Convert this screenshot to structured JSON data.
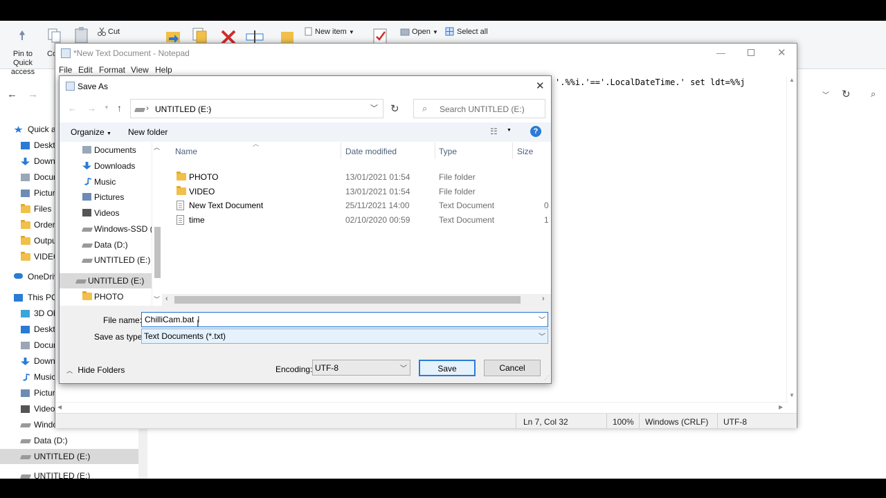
{
  "explorer": {
    "ribbon": {
      "pin_label": "Pin to Quick access",
      "copy_label": "Co",
      "cut_label": "Cut",
      "new_item_label": "New item",
      "open_label": "Open",
      "select_all_label": "Select all"
    },
    "sidebar": {
      "items": [
        {
          "label": "Quick a",
          "icon": "star-icon"
        },
        {
          "label": "Deskt",
          "icon": "desktop-icon"
        },
        {
          "label": "Down",
          "icon": "download-icon"
        },
        {
          "label": "Docur",
          "icon": "documents-icon"
        },
        {
          "label": "Picture",
          "icon": "pictures-icon"
        },
        {
          "label": "Files",
          "icon": "folder-icon"
        },
        {
          "label": "Order",
          "icon": "folder-icon"
        },
        {
          "label": "Outpu",
          "icon": "folder-icon"
        },
        {
          "label": "VIDEO",
          "icon": "folder-icon"
        },
        {
          "label": "OneDriv",
          "icon": "cloud-icon"
        },
        {
          "label": "This PC",
          "icon": "computer-icon"
        },
        {
          "label": "3D Ob",
          "icon": "3d-objects-icon"
        },
        {
          "label": "Deskt",
          "icon": "desktop-icon"
        },
        {
          "label": "Docur",
          "icon": "documents-icon"
        },
        {
          "label": "Down",
          "icon": "download-icon"
        },
        {
          "label": "Music",
          "icon": "music-icon"
        },
        {
          "label": "Pictur",
          "icon": "pictures-icon"
        },
        {
          "label": "Video",
          "icon": "videos-icon"
        },
        {
          "label": "Windo",
          "icon": "drive-icon"
        },
        {
          "label": "Data (D:)",
          "icon": "drive-icon"
        },
        {
          "label": "UNTITLED (E:)",
          "icon": "drive-icon"
        },
        {
          "label": "UNTITLED (E:)",
          "icon": "drive-icon"
        }
      ]
    }
  },
  "notepad": {
    "title": "*New Text Document - Notepad",
    "menu": [
      "File",
      "Edit",
      "Format",
      "View",
      "Help"
    ],
    "visible_text": "'.%%i.'=='.LocalDateTime.' set ldt=%%j",
    "status": {
      "position": "Ln 7, Col 32",
      "zoom": "100%",
      "line_ending": "Windows (CRLF)",
      "encoding": "UTF-8"
    }
  },
  "dialog": {
    "title": "Save As",
    "address": {
      "location": "UNTITLED (E:)"
    },
    "search_placeholder": "Search UNTITLED (E:)",
    "organize_label": "Organize",
    "new_folder_label": "New folder",
    "tree": [
      {
        "label": "Documents",
        "icon": "documents-icon"
      },
      {
        "label": "Downloads",
        "icon": "download-icon"
      },
      {
        "label": "Music",
        "icon": "music-icon"
      },
      {
        "label": "Pictures",
        "icon": "pictures-icon"
      },
      {
        "label": "Videos",
        "icon": "videos-icon"
      },
      {
        "label": "Windows-SSD (C",
        "icon": "drive-icon"
      },
      {
        "label": "Data (D:)",
        "icon": "drive-icon"
      },
      {
        "label": "UNTITLED (E:)",
        "icon": "drive-icon"
      },
      {
        "label": "UNTITLED (E:)",
        "icon": "drive-icon"
      },
      {
        "label": "PHOTO",
        "icon": "folder-icon"
      }
    ],
    "columns": {
      "name": "Name",
      "date": "Date modified",
      "type": "Type",
      "size": "Size"
    },
    "files": [
      {
        "name": "PHOTO",
        "date": "13/01/2021 01:54",
        "type": "File folder",
        "size": "",
        "icon": "folder-icon"
      },
      {
        "name": "VIDEO",
        "date": "13/01/2021 01:54",
        "type": "File folder",
        "size": "",
        "icon": "folder-icon"
      },
      {
        "name": "New Text Document",
        "date": "25/11/2021 14:00",
        "type": "Text Document",
        "size": "0",
        "icon": "text-file-icon"
      },
      {
        "name": "time",
        "date": "02/10/2020 00:59",
        "type": "Text Document",
        "size": "1",
        "icon": "text-file-icon"
      }
    ],
    "file_name_label": "File name:",
    "file_name_value": "ChilliCam.bat",
    "save_type_label": "Save as type:",
    "save_type_value": "Text Documents (*.txt)",
    "hide_folders_label": "Hide Folders",
    "encoding_label": "Encoding:",
    "encoding_value": "UTF-8",
    "save_label": "Save",
    "cancel_label": "Cancel"
  }
}
